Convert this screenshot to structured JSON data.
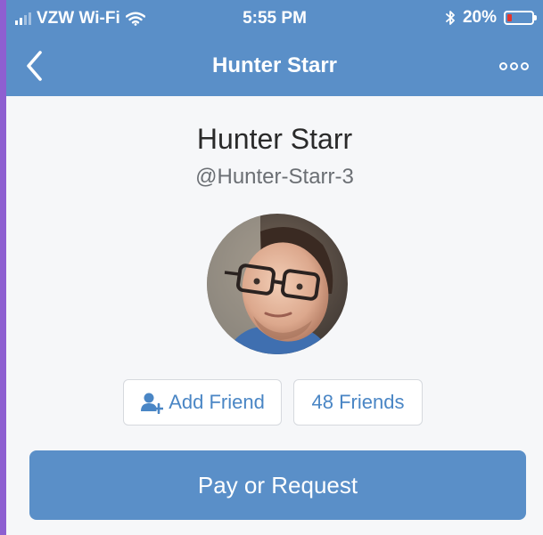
{
  "status_bar": {
    "carrier": "VZW Wi-Fi",
    "time": "5:55 PM",
    "battery_percent": "20%",
    "battery_level": 0.2,
    "signal_icon": "cellular-signal-icon",
    "wifi_icon": "wifi-icon",
    "bluetooth_icon": "bluetooth-icon",
    "battery_icon": "battery-icon"
  },
  "nav": {
    "title": "Hunter Starr",
    "back_icon": "chevron-left-icon",
    "more_icon": "more-options-icon"
  },
  "profile": {
    "name": "Hunter Starr",
    "handle": "@Hunter-Starr-3",
    "avatar_icon": "profile-photo"
  },
  "actions": {
    "add_friend_label": "Add Friend",
    "add_friend_icon": "add-person-icon",
    "friends_label": "48 Friends",
    "pay_label": "Pay or Request"
  },
  "colors": {
    "brand_blue": "#5a8fc8",
    "link_blue": "#4a86c5",
    "battery_low": "#e5342c",
    "background": "#f6f7f9"
  }
}
